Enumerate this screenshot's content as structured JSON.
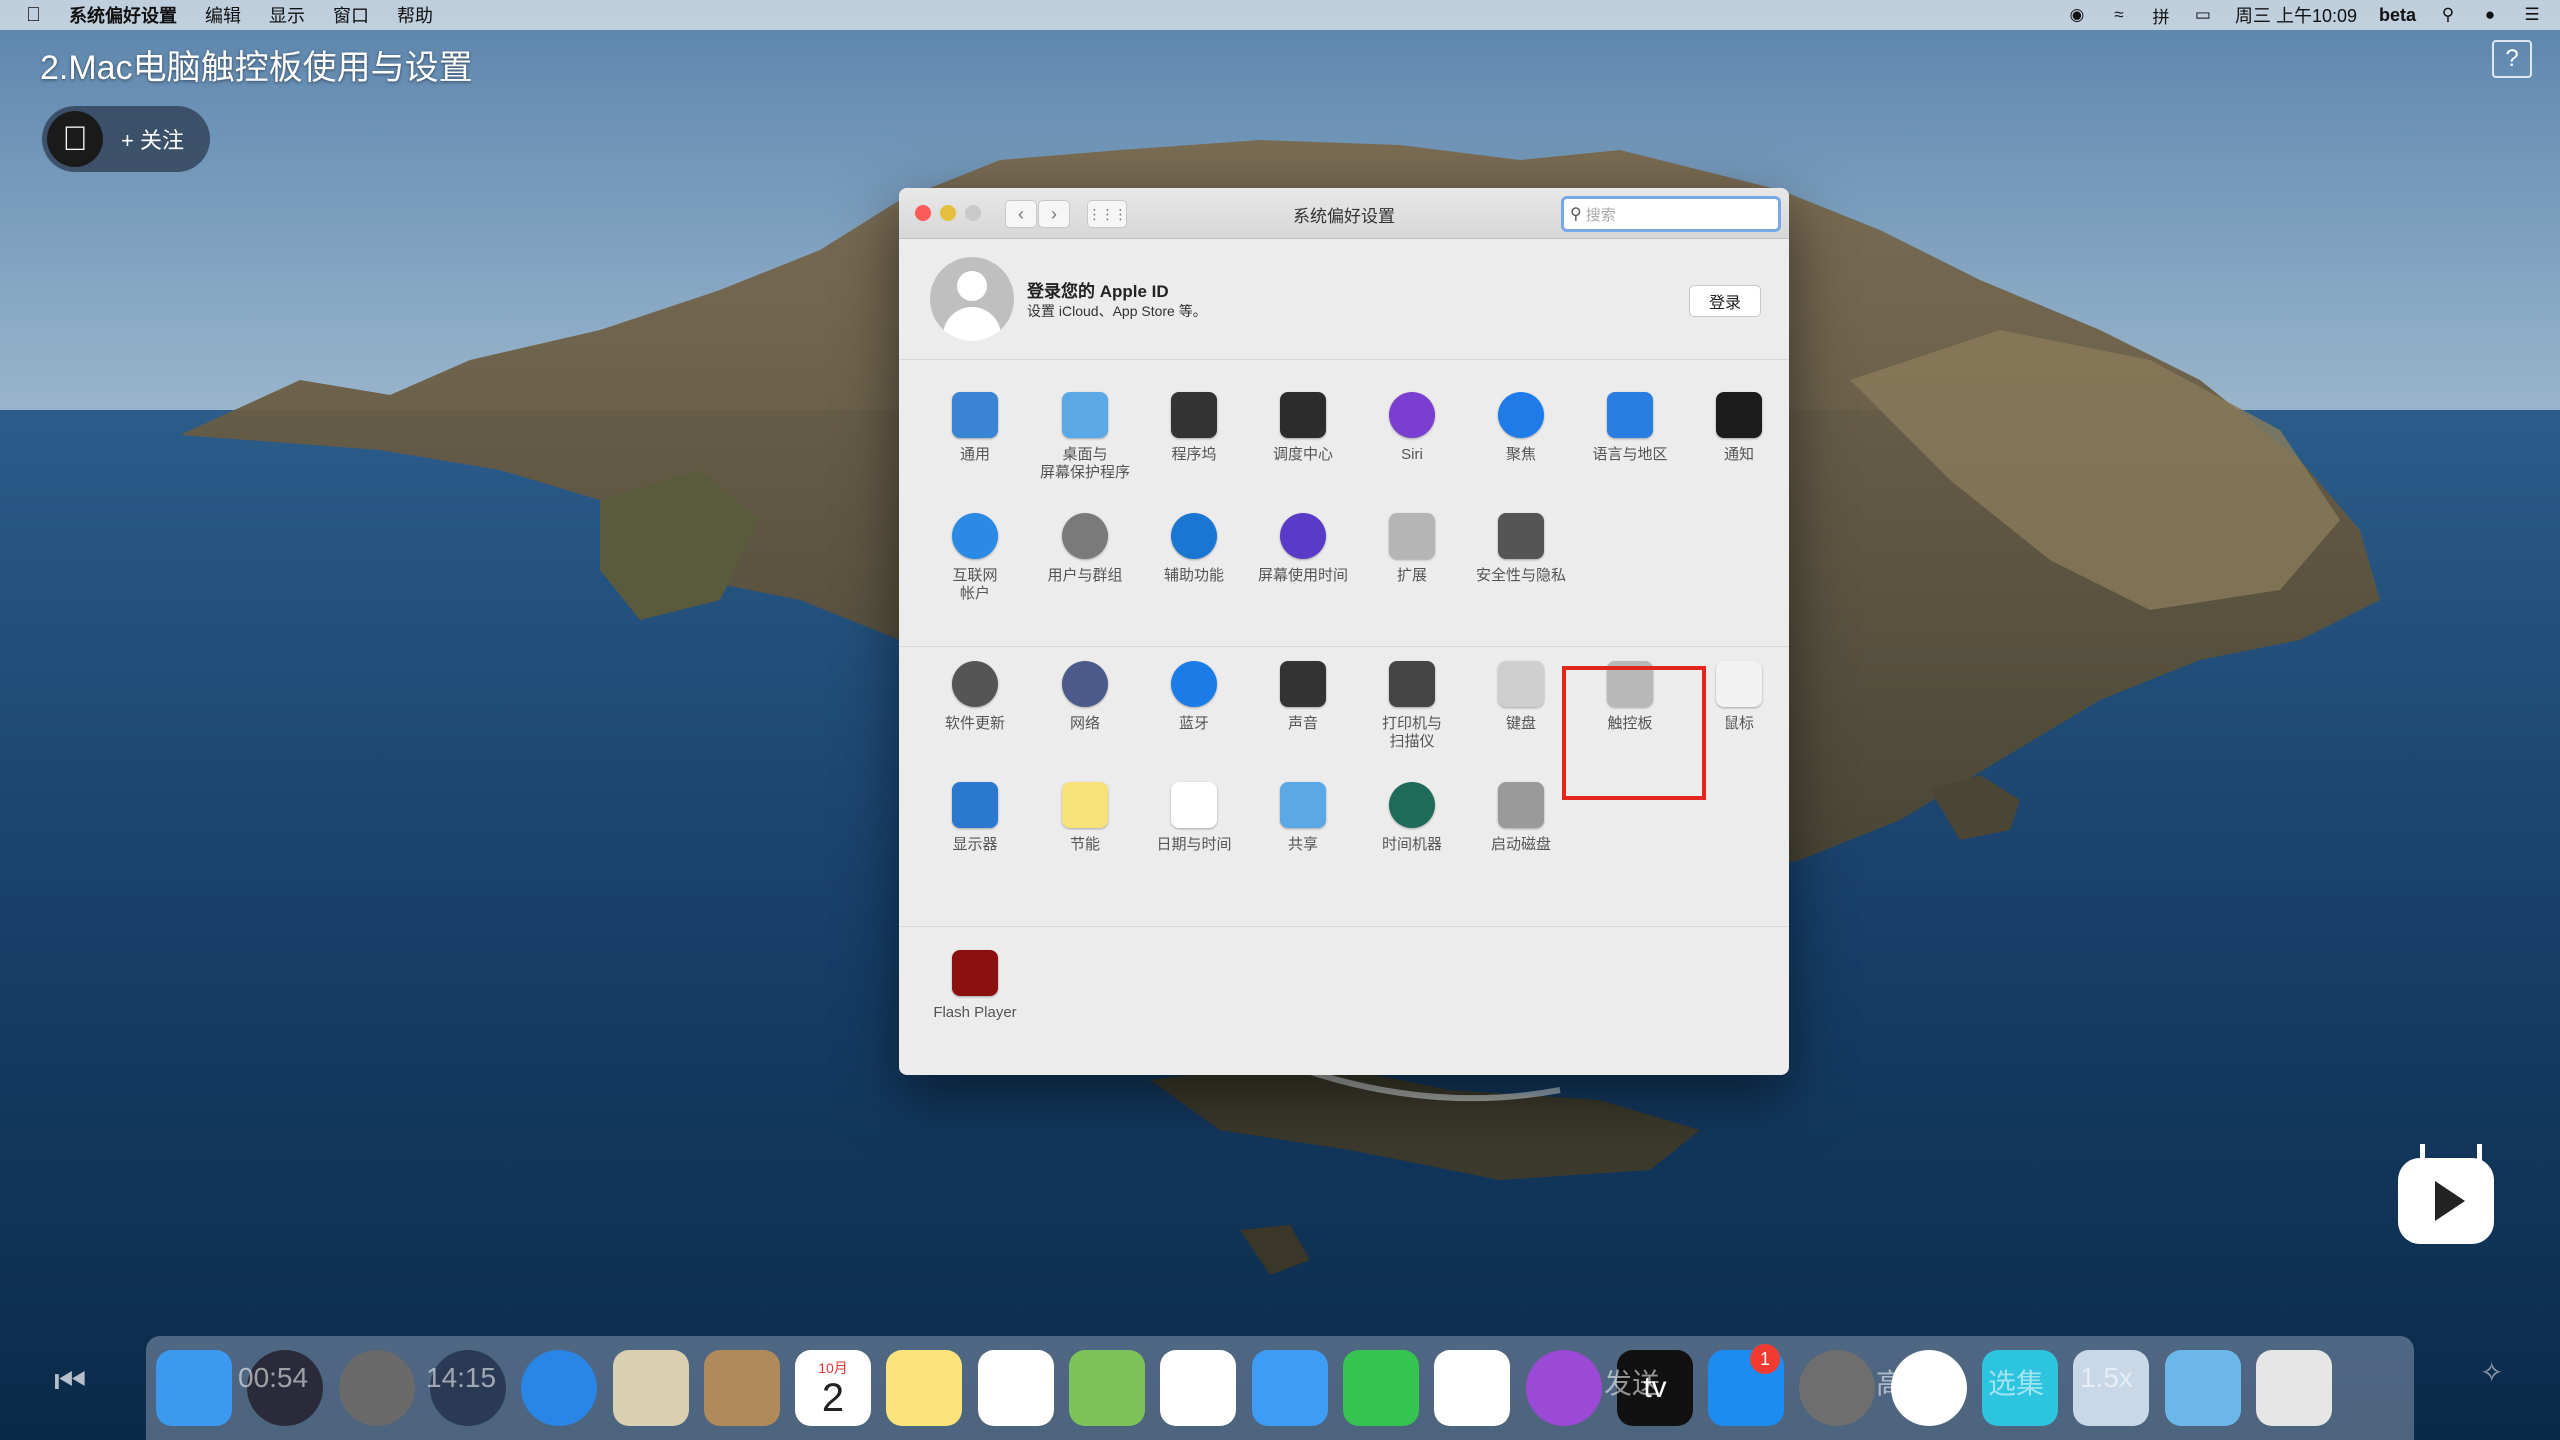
{
  "menubar": {
    "app_name": "系统偏好设置",
    "menus": [
      "编辑",
      "显示",
      "窗口",
      "帮助"
    ],
    "clock": "周三 上午10:09",
    "beta": "beta",
    "input_method": "拼"
  },
  "video": {
    "title": "2.Mac电脑触控板使用与设置",
    "follow_label": "+ 关注",
    "help_label": "?"
  },
  "window": {
    "title": "系统偏好设置",
    "search_placeholder": "搜索",
    "apple_id": {
      "title": "登录您的 Apple ID",
      "subtitle": "设置 iCloud、App Store 等。",
      "login_button": "登录"
    },
    "row1": [
      {
        "label": "通用",
        "icon": "general-icon",
        "color": "#3a84d6"
      },
      {
        "label": "桌面与\n屏幕保护程序",
        "icon": "desktop-icon",
        "color": "#5aa9e6"
      },
      {
        "label": "程序坞",
        "icon": "dock-icon",
        "color": "#333333"
      },
      {
        "label": "调度中心",
        "icon": "mission-control-icon",
        "color": "#2c2c2c"
      },
      {
        "label": "Siri",
        "icon": "siri-icon",
        "color": "#7a3fd0"
      },
      {
        "label": "聚焦",
        "icon": "spotlight-icon",
        "color": "#1e7be8"
      },
      {
        "label": "语言与地区",
        "icon": "language-icon",
        "color": "#2a7de1"
      },
      {
        "label": "通知",
        "icon": "notifications-icon",
        "color": "#1c1c1c"
      }
    ],
    "row2": [
      {
        "label": "互联网\n帐户",
        "icon": "internet-accounts-icon",
        "color": "#2b8ae6"
      },
      {
        "label": "用户与群组",
        "icon": "users-icon",
        "color": "#7a7a7a"
      },
      {
        "label": "辅助功能",
        "icon": "accessibility-icon",
        "color": "#1976d2"
      },
      {
        "label": "屏幕使用时间",
        "icon": "screen-time-icon",
        "color": "#5a3bc7"
      },
      {
        "label": "扩展",
        "icon": "extensions-icon",
        "color": "#b5b5b5"
      },
      {
        "label": "安全性与隐私",
        "icon": "security-icon",
        "color": "#555555"
      }
    ],
    "row3": [
      {
        "label": "软件更新",
        "icon": "software-update-icon",
        "color": "#555555"
      },
      {
        "label": "网络",
        "icon": "network-icon",
        "color": "#4a5a8a"
      },
      {
        "label": "蓝牙",
        "icon": "bluetooth-icon",
        "color": "#1b7ce8"
      },
      {
        "label": "声音",
        "icon": "sound-icon",
        "color": "#333333"
      },
      {
        "label": "打印机与\n扫描仪",
        "icon": "printer-icon",
        "color": "#444444"
      },
      {
        "label": "键盘",
        "icon": "keyboard-icon",
        "color": "#cfcfcf"
      },
      {
        "label": "触控板",
        "icon": "trackpad-icon",
        "color": "#b8b8b8"
      },
      {
        "label": "鼠标",
        "icon": "mouse-icon",
        "color": "#f2f2f2"
      }
    ],
    "row4": [
      {
        "label": "显示器",
        "icon": "display-icon",
        "color": "#2a78d0"
      },
      {
        "label": "节能",
        "icon": "energy-saver-icon",
        "color": "#f7e27a"
      },
      {
        "label": "日期与时间",
        "icon": "date-time-icon",
        "color": "#ffffff"
      },
      {
        "label": "共享",
        "icon": "sharing-icon",
        "color": "#5aa9e6"
      },
      {
        "label": "时间机器",
        "icon": "time-machine-icon",
        "color": "#1e6b5a"
      },
      {
        "label": "启动磁盘",
        "icon": "startup-disk-icon",
        "color": "#9a9a9a"
      }
    ],
    "row5": [
      {
        "label": "Flash Player",
        "icon": "flash-player-icon",
        "color": "#8b1010"
      }
    ]
  },
  "player": {
    "time_current": "00:54",
    "time_total": "14:15",
    "overlay_quality": "高清",
    "overlay_select": "选集",
    "overlay_speed": "1.5x",
    "overlay_send": "发送"
  },
  "dock": {
    "calendar_month": "10月",
    "calendar_day": "2",
    "appstore_badge": "1",
    "appletv_label": "tv",
    "items": [
      {
        "name": "finder-icon",
        "color": "#3b9af0"
      },
      {
        "name": "siri-icon",
        "color": "#2a2a3a"
      },
      {
        "name": "launchpad-icon",
        "color": "#6a6a6a"
      },
      {
        "name": "quicktime-icon",
        "color": "#2a3a55"
      },
      {
        "name": "safari-icon",
        "color": "#2a86e6"
      },
      {
        "name": "mail-icon",
        "color": "#d8d0b0"
      },
      {
        "name": "contacts-icon",
        "color": "#b08a5a"
      },
      {
        "name": "calendar-icon",
        "color": "#ffffff"
      },
      {
        "name": "notes-icon",
        "color": "#fbe57a"
      },
      {
        "name": "reminders-icon",
        "color": "#ffffff"
      },
      {
        "name": "maps-icon",
        "color": "#7cc35a"
      },
      {
        "name": "photos-icon",
        "color": "#ffffff"
      },
      {
        "name": "messages-icon",
        "color": "#3d9df5"
      },
      {
        "name": "facetime-icon",
        "color": "#38c452"
      },
      {
        "name": "music-icon",
        "color": "#ffffff"
      },
      {
        "name": "podcasts-icon",
        "color": "#9c49d6"
      },
      {
        "name": "appletv-icon",
        "color": "#111111"
      },
      {
        "name": "appstore-icon",
        "color": "#1d8cf2"
      },
      {
        "name": "system-preferences-icon",
        "color": "#6e6e6e"
      },
      {
        "name": "chrome-icon",
        "color": "#ffffff"
      },
      {
        "name": "infuse-icon",
        "color": "#2dc4e0"
      },
      {
        "name": "preview-icon",
        "color": "#c8d8e8"
      },
      {
        "name": "downloads-folder-icon",
        "color": "#6bb7ea"
      },
      {
        "name": "trash-icon",
        "color": "#e6e6e6"
      }
    ]
  }
}
